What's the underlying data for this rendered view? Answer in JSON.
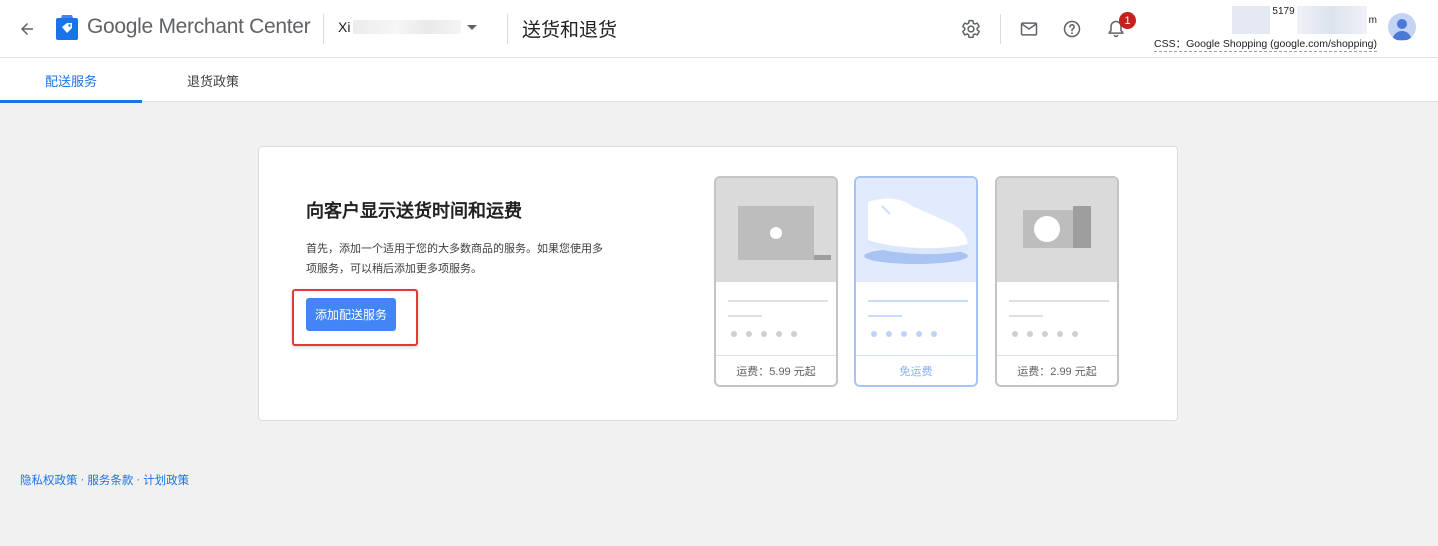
{
  "header": {
    "brand_google": "Google",
    "brand_product": "Merchant Center",
    "account_name_prefix": "Xi",
    "page_title": "送货和退货",
    "notification_count": "1",
    "account_id_fragment": "5179",
    "account_suffix": "m",
    "css_label": "CSS：Google Shopping (google.com/shopping)"
  },
  "tabs": [
    {
      "label": "配送服务",
      "active": true
    },
    {
      "label": "退货政策",
      "active": false
    }
  ],
  "card": {
    "title": "向客户显示送货时间和运费",
    "description": "首先，添加一个适用于您的大多数商品的服务。如果您使用多项服务，可以稍后添加更多项服务。",
    "primary_button": "添加配送服务"
  },
  "illustration": [
    {
      "icon": "laptop-icon",
      "price_label": "运费：5.99 元起",
      "selected": false
    },
    {
      "icon": "shoe-icon",
      "price_label": "免运费",
      "selected": true
    },
    {
      "icon": "camera-icon",
      "price_label": "运费：2.99 元起",
      "selected": false
    }
  ],
  "footer": {
    "privacy": "隐私权政策",
    "terms": "服务条款",
    "program": "计划政策",
    "separator": "·"
  },
  "colors": {
    "accent": "#1a73e8",
    "button": "#4285f4",
    "highlight": "#e53935",
    "badge": "#c5221f"
  }
}
